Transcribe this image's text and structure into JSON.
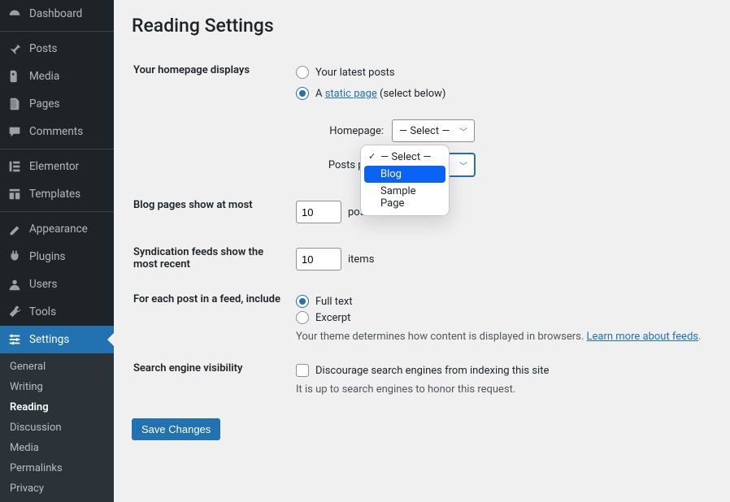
{
  "sidebar": {
    "items": [
      {
        "label": "Dashboard",
        "icon": "dashboard"
      },
      {
        "label": "Posts",
        "icon": "pin"
      },
      {
        "label": "Media",
        "icon": "media"
      },
      {
        "label": "Pages",
        "icon": "pages"
      },
      {
        "label": "Comments",
        "icon": "comment"
      },
      {
        "label": "Elementor",
        "icon": "elementor"
      },
      {
        "label": "Templates",
        "icon": "templates"
      },
      {
        "label": "Appearance",
        "icon": "appearance"
      },
      {
        "label": "Plugins",
        "icon": "plugin"
      },
      {
        "label": "Users",
        "icon": "user"
      },
      {
        "label": "Tools",
        "icon": "tools"
      },
      {
        "label": "Settings",
        "icon": "settings"
      }
    ],
    "submenu": [
      {
        "label": "General"
      },
      {
        "label": "Writing"
      },
      {
        "label": "Reading"
      },
      {
        "label": "Discussion"
      },
      {
        "label": "Media"
      },
      {
        "label": "Permalinks"
      },
      {
        "label": "Privacy"
      }
    ],
    "active": "Settings",
    "subactive": "Reading"
  },
  "page": {
    "title": "Reading Settings",
    "hpd_label": "Your homepage displays",
    "hpd_opt1": "Your latest posts",
    "hpd_opt2_pre": "A ",
    "hpd_opt2_link": "static page",
    "hpd_opt2_post": " (select below)",
    "hp_label": "Homepage:",
    "pp_label": "Posts page:",
    "select_placeholder": "— Select —",
    "dropdown_options": [
      {
        "label": "— Select —"
      },
      {
        "label": "Blog"
      },
      {
        "label": "Sample Page"
      }
    ],
    "blog_pages_label": "Blog pages show at most",
    "blog_pages_value": "10",
    "blog_pages_unit": "posts",
    "synd_label": "Syndication feeds show the most recent",
    "synd_value": "10",
    "synd_unit": "items",
    "feed_label": "For each post in a feed, include",
    "feed_opt1": "Full text",
    "feed_opt2": "Excerpt",
    "feed_desc_pre": "Your theme determines how content is displayed in browsers. ",
    "feed_desc_link": "Learn more about feeds",
    "feed_desc_post": ".",
    "sev_label": "Search engine visibility",
    "sev_cb": "Discourage search engines from indexing this site",
    "sev_desc": "It is up to search engines to honor this request.",
    "save_label": "Save Changes"
  }
}
